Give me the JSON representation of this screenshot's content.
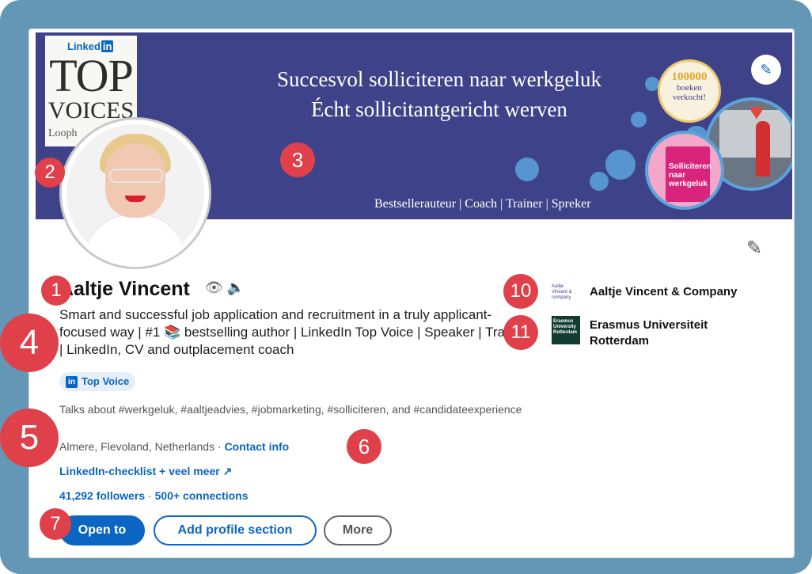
{
  "banner": {
    "top_voices_brand": "Linked",
    "top_voices_brand_in": "in",
    "top_voices_top": "TOP",
    "top_voices_voices": "VOICES",
    "top_voices_loop": "Looph",
    "title_line1": "Succesvol solliciteren naar werkgeluk",
    "title_line2": "Écht sollicitantgericht werven",
    "subtitle": "Bestsellerauteur | Coach | Trainer | Spreker",
    "sold_badge_number": "100000",
    "sold_badge_text": "boeken verkocht!",
    "book_title": "Solliciteren naar werkgeluk"
  },
  "profile": {
    "name": "Aaltje Vincent",
    "name_icons": "👁 🔈",
    "headline": "Smart and successful job application and recruitment in a truly applicant-focused way | #1 📚 bestselling author | LinkedIn Top Voice | Speaker | Trainer | LinkedIn, CV and outplacement coach",
    "top_voice_badge_icon": "in",
    "top_voice_badge": "Top Voice",
    "talks_about": "Talks about #werkgeluk, #aaltjeadvies, #jobmarketing, #solliciteren, and #candidateexperience",
    "location": "Almere, Flevoland, Netherlands",
    "location_separator": " · ",
    "contact_info": "Contact info",
    "external_link": "LinkedIn-checklist + veel meer",
    "external_link_icon": "↗",
    "followers": "41,292 followers",
    "stats_separator": " · ",
    "connections": "500+ connections"
  },
  "actions": {
    "open_to": "Open to",
    "add_section": "Add profile section",
    "more": "More"
  },
  "experience": {
    "company_logo_text": "Aaltje Vincent & company",
    "company": "Aaltje Vincent & Company",
    "education_logo_text": "Erasmus University Rotterdam",
    "education": "Erasmus Universiteit Rotterdam"
  },
  "markers": [
    "1",
    "2",
    "3",
    "4",
    "5",
    "6",
    "7",
    "10",
    "11"
  ],
  "icons": {
    "edit_banner": "pencil-icon",
    "edit_profile": "pencil-icon",
    "external_link": "external-link-icon"
  },
  "colors": {
    "brand_blue": "#0a66c2",
    "banner_bg": "#3e4389",
    "marker_red": "#e0404a",
    "frame": "#6497b5"
  }
}
